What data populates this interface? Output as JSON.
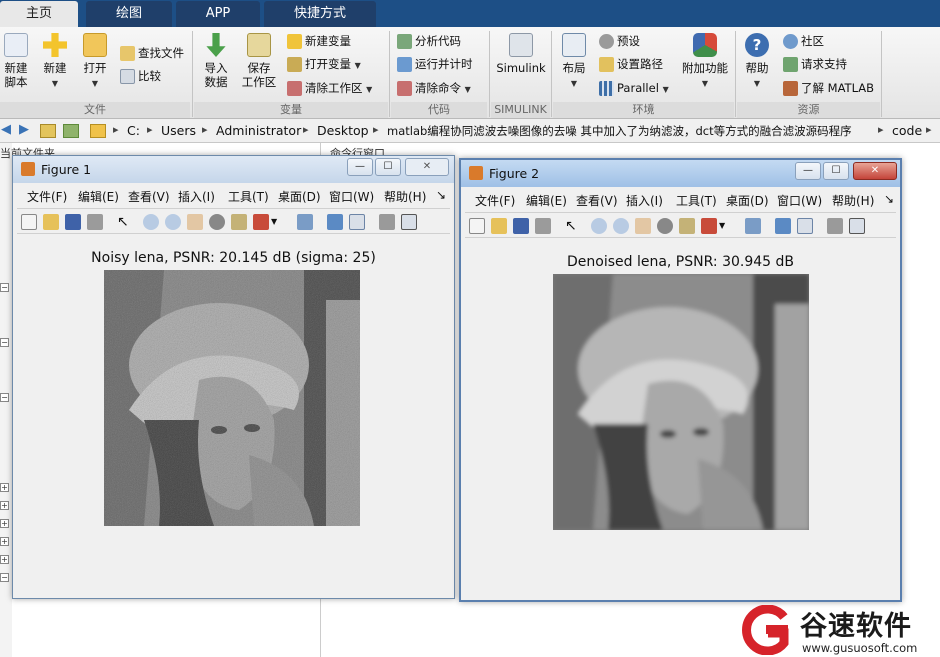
{
  "tabs": [
    "主页",
    "绘图",
    "APP",
    "快捷方式"
  ],
  "ribbon": {
    "new_script": "新建\n脚本",
    "new": "新建",
    "open": "打开",
    "find_files": "查找文件",
    "compare": "比较",
    "group_file": "文件",
    "import_data": "导入\n数据",
    "save_workspace": "保存\n工作区",
    "new_variable": "新建变量",
    "open_variable": "打开变量",
    "clear_workspace": "清除工作区",
    "group_variable": "变量",
    "analyze_code": "分析代码",
    "run_and_time": "运行并计时",
    "clear_commands": "清除命令",
    "group_code": "代码",
    "simulink": "Simulink",
    "group_simulink": "SIMULINK",
    "layout": "布局",
    "preferences": "预设",
    "set_path": "设置路径",
    "parallel": "Parallel",
    "group_environment": "环境",
    "addons": "附加功能",
    "help": "帮助",
    "community": "社区",
    "request_support": "请求支持",
    "learn_matlab": "了解 MATLAB",
    "group_resources": "资源"
  },
  "address": {
    "crumbs": [
      "C:",
      "Users",
      "Administrator",
      "Desktop",
      "matlab编程协同滤波去噪图像的去噪 其中加入了为纳滤波，dct等方式的融合滤波源码程序",
      "code"
    ]
  },
  "panes": {
    "current_folder": "当前文件夹",
    "command_window": "命令行窗口"
  },
  "figure1": {
    "title": "Figure 1",
    "menu": [
      "文件(F)",
      "编辑(E)",
      "查看(V)",
      "插入(I)",
      "工具(T)",
      "桌面(D)",
      "窗口(W)",
      "帮助(H)"
    ],
    "plot_title": "Noisy lena, PSNR: 20.145 dB (sigma: 25)"
  },
  "figure2": {
    "title": "Figure 2",
    "menu": [
      "文件(F)",
      "编辑(E)",
      "查看(V)",
      "插入(I)",
      "工具(T)",
      "桌面(D)",
      "窗口(W)",
      "帮助(H)"
    ],
    "plot_title": "Denoised lena, PSNR: 30.945 dB"
  },
  "watermark": {
    "name": "谷速软件",
    "url": "www.gusuosoft.com"
  },
  "colors": {
    "tabbar": "#1d4f86",
    "watermark_red": "#d6232a"
  }
}
